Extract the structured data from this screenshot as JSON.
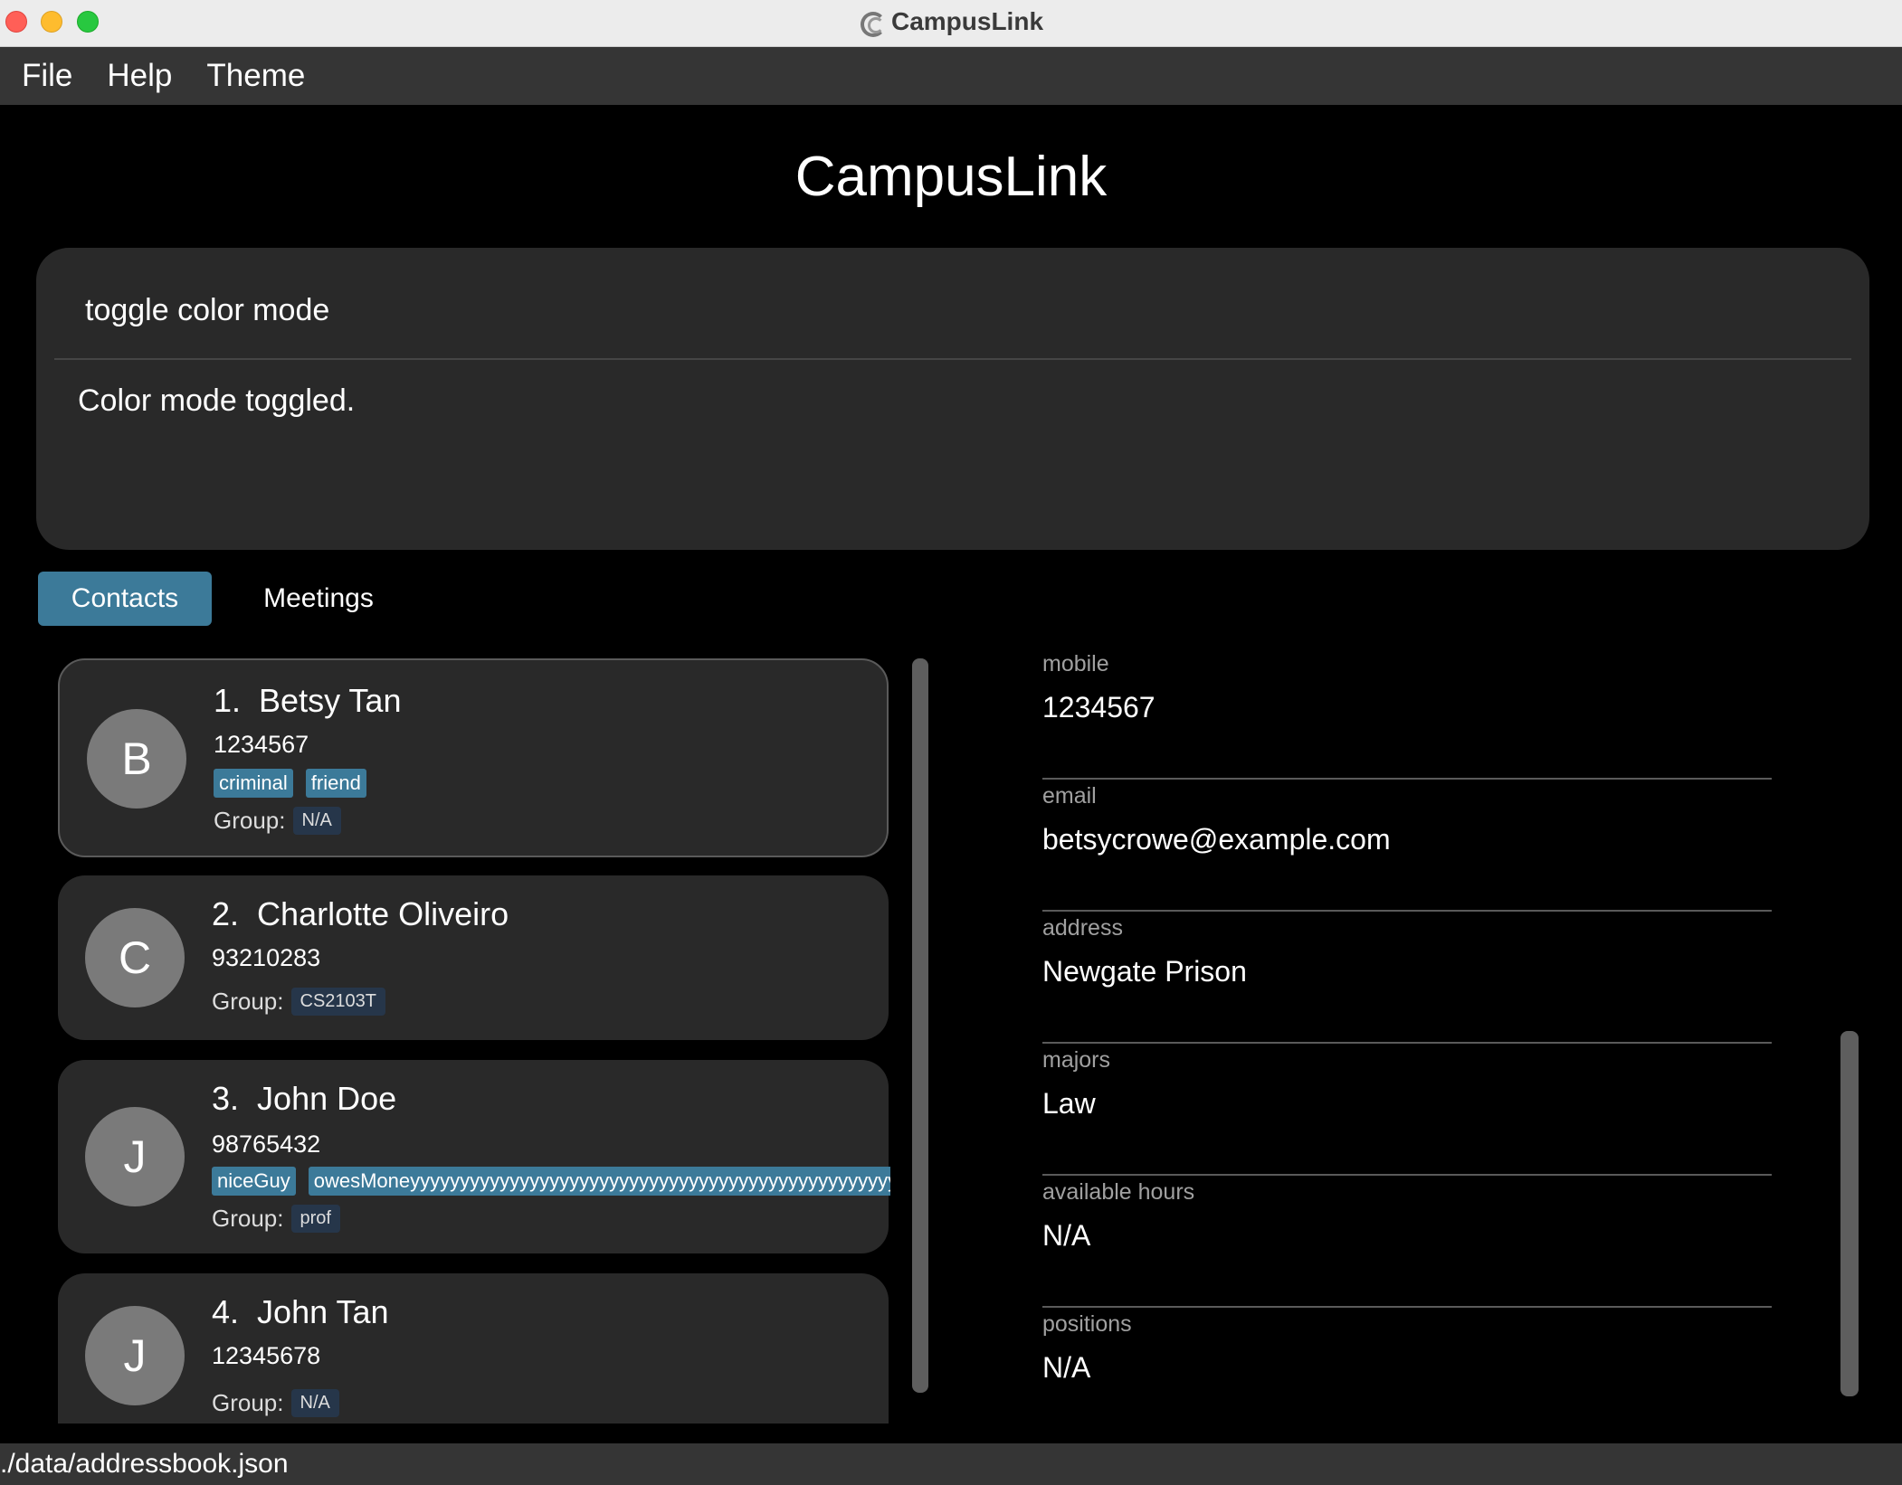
{
  "window": {
    "title": "CampusLink"
  },
  "menu": {
    "items": [
      "File",
      "Help",
      "Theme"
    ]
  },
  "header": {
    "title": "CampusLink"
  },
  "command": {
    "input_value": "toggle color mode",
    "result": "Color mode toggled."
  },
  "tabs": [
    {
      "label": "Contacts",
      "active": true
    },
    {
      "label": "Meetings",
      "active": false
    }
  ],
  "group_label": "Group:",
  "contacts": [
    {
      "index": "1.",
      "name": "Betsy Tan",
      "initial": "B",
      "phone": "1234567",
      "tags": [
        "criminal",
        "friend"
      ],
      "group": "N/A"
    },
    {
      "index": "2.",
      "name": "Charlotte Oliveiro",
      "initial": "C",
      "phone": "93210283",
      "tags": [],
      "group": "CS2103T"
    },
    {
      "index": "3.",
      "name": "John Doe",
      "initial": "J",
      "phone": "98765432",
      "tags": [
        "niceGuy",
        "owesMoneyyyyyyyyyyyyyyyyyyyyyyyyyyyyyyyyyyyyyyyyyyyyyyyyy"
      ],
      "group": "prof"
    },
    {
      "index": "4.",
      "name": "John Tan",
      "initial": "J",
      "phone": "12345678",
      "tags": [],
      "group": "N/A"
    }
  ],
  "details": [
    {
      "label": "mobile",
      "value": "1234567"
    },
    {
      "label": "email",
      "value": "betsycrowe@example.com"
    },
    {
      "label": "address",
      "value": "Newgate Prison"
    },
    {
      "label": "majors",
      "value": "Law"
    },
    {
      "label": "available hours",
      "value": "N/A"
    },
    {
      "label": "positions",
      "value": "N/A"
    }
  ],
  "status": {
    "path": "./data/addressbook.json"
  },
  "colors": {
    "accent": "#3c7a99",
    "panel": "#292929",
    "menubar": "#353535",
    "group_tag": "#26364a"
  }
}
